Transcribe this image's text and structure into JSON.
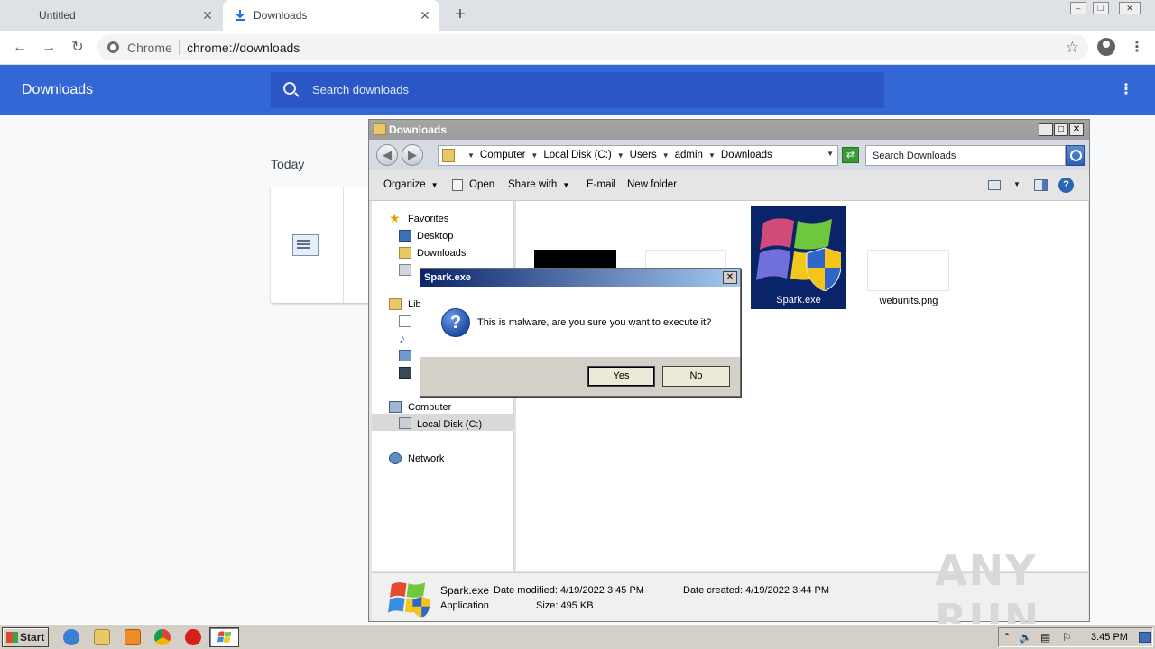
{
  "browser": {
    "tabs": [
      {
        "label": "Untitled",
        "active": false
      },
      {
        "label": "Downloads",
        "active": true
      }
    ],
    "new_tab_symbol": "+",
    "omnibox": {
      "site_label": "Chrome",
      "url": "chrome://downloads"
    }
  },
  "downloads_page": {
    "title": "Downloads",
    "search_placeholder": "Search downloads",
    "section_today": "Today"
  },
  "explorer": {
    "title": "Downloads",
    "breadcrumbs": [
      "Computer",
      "Local Disk (C:)",
      "Users",
      "admin",
      "Downloads"
    ],
    "search_placeholder": "Search Downloads",
    "commands": {
      "organize": "Organize",
      "open": "Open",
      "share_with": "Share with",
      "email": "E-mail",
      "new_folder": "New folder"
    },
    "nav": {
      "favorites": "Favorites",
      "desktop": "Desktop",
      "downloads": "Downloads",
      "libraries_partial": "Libr",
      "computer": "Computer",
      "local_disk": "Local Disk (C:)",
      "network": "Network"
    },
    "files": {
      "spark": "Spark.exe",
      "webunits": "webunits.png"
    },
    "details": {
      "name": "Spark.exe",
      "type": "Application",
      "date_modified": "Date modified: 4/19/2022 3:45 PM",
      "date_created": "Date created: 4/19/2022 3:44 PM",
      "size": "Size: 495 KB"
    }
  },
  "dialog": {
    "title": "Spark.exe",
    "message": "This is malware, are you sure you want to execute it?",
    "yes_label": "Yes",
    "no_label": "No"
  },
  "taskbar": {
    "start_label": "Start",
    "clock": "3:45 PM"
  },
  "watermark": "ANY RUN",
  "colors": {
    "chrome_header_blue": "#3367d6",
    "dialog_title_start": "#0a246a",
    "taskbar_gray": "#d4d0c8"
  }
}
